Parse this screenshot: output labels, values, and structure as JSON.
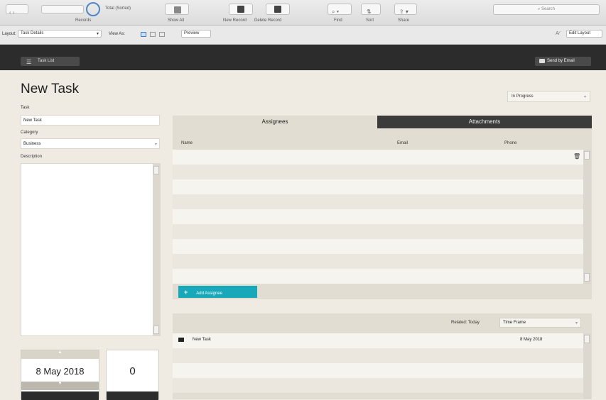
{
  "toolbar": {
    "records_count": "Total (Sorted)",
    "records_label": "Records",
    "show_all": "Show All",
    "new_record": "New Record",
    "delete_record": "Delete Record",
    "find": "Find",
    "sort": "Sort",
    "share": "Share",
    "search_placeholder": "Search"
  },
  "layoutbar": {
    "layout_label": "Layout:",
    "layout_value": "Task Details",
    "view_as_label": "View As:",
    "preview": "Preview",
    "edit_layout": "Edit Layout"
  },
  "header": {
    "task_list": "Task List",
    "send_email": "Send by Email"
  },
  "form": {
    "title": "New Task",
    "status": "In Progress",
    "task_label": "Task",
    "task_value": "New Task",
    "category_label": "Category",
    "category_value": "Business",
    "description_label": "Description"
  },
  "tabs": {
    "assignees": "Assignees",
    "attachments": "Attachments"
  },
  "assignees": {
    "columns": [
      "Name",
      "Email",
      "Phone"
    ],
    "add_button": "Add Assignee"
  },
  "related": {
    "label": "Related: Today",
    "timeframe": "Time Frame",
    "rows": [
      {
        "name": "New Task",
        "date": "8 May 2018"
      }
    ]
  },
  "footer": {
    "date": "8 May 2018",
    "count": "0"
  },
  "colors": {
    "accent": "#17a9b9",
    "dark_bar": "#2c2c2c",
    "background": "#efebe3"
  }
}
